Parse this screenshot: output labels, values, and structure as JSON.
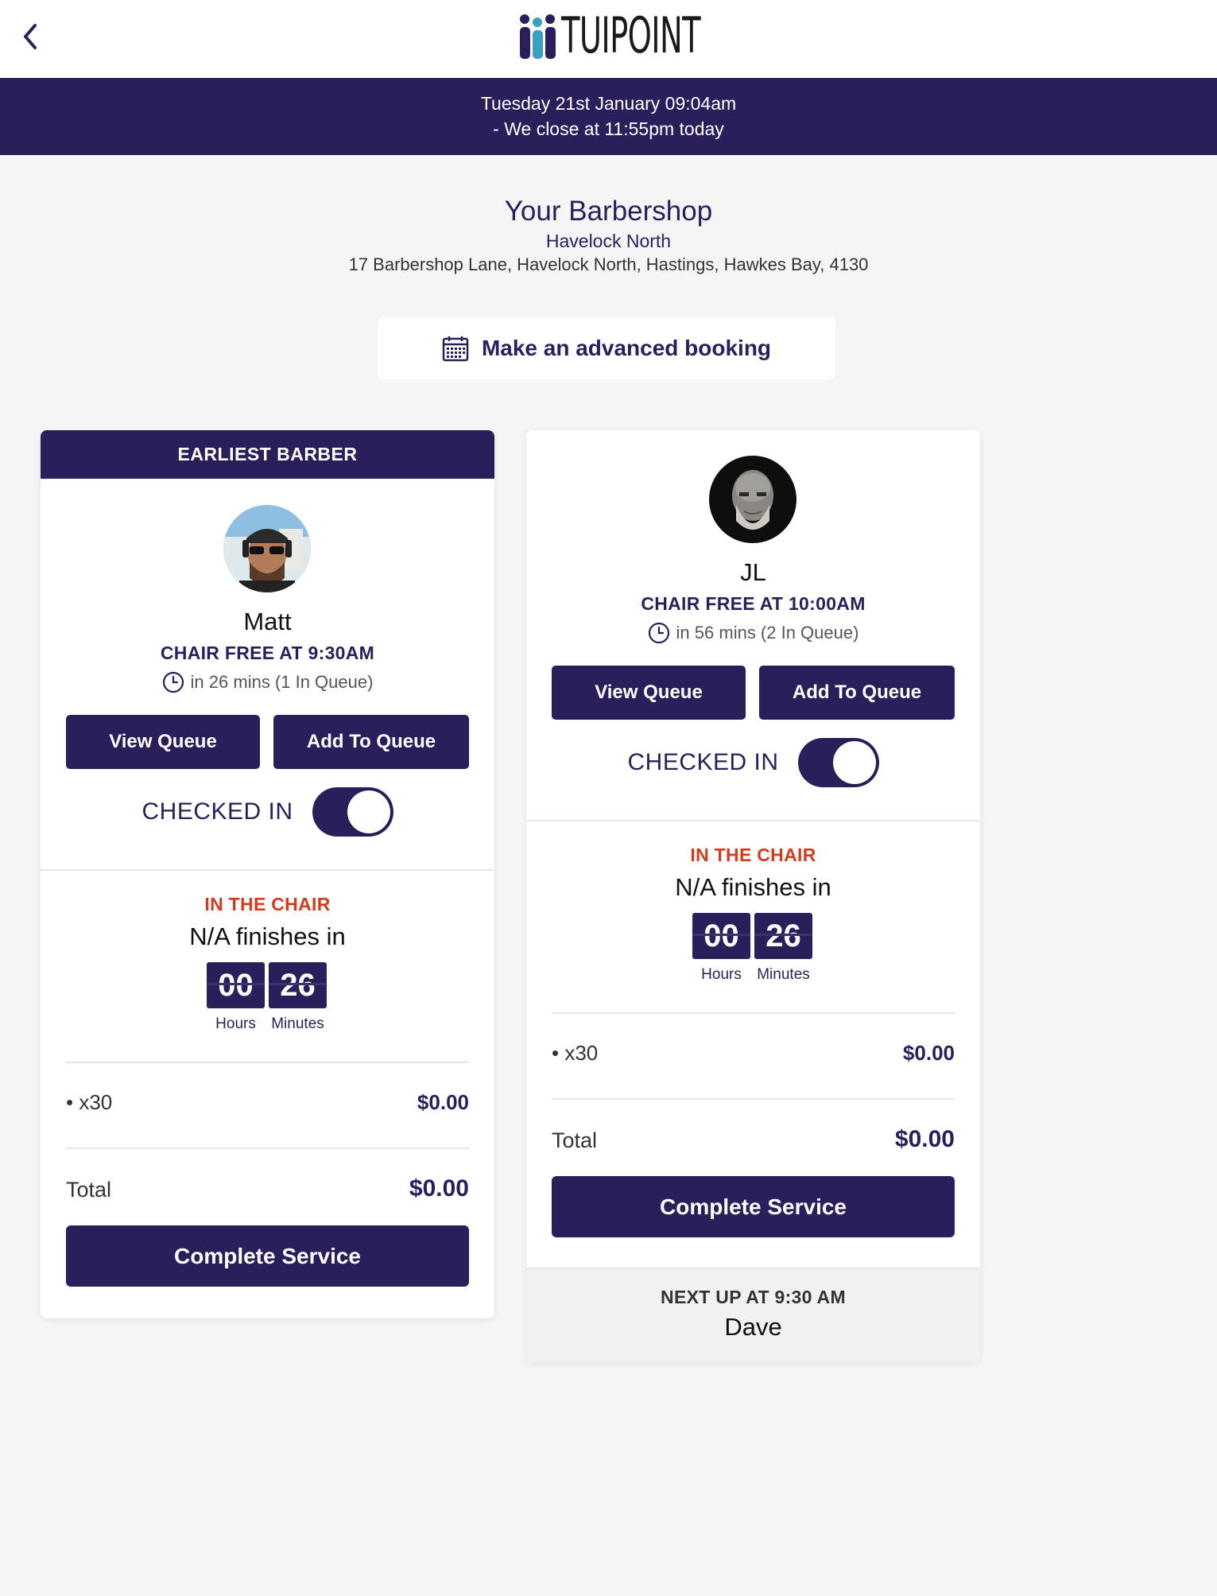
{
  "header": {
    "brand": "TUIPOINT",
    "back_icon": "chevron-left-icon"
  },
  "banner": {
    "datetime": "Tuesday 21st January 09:04am",
    "closing": "- We close at 11:55pm today"
  },
  "shop": {
    "name": "Your Barbershop",
    "area": "Havelock North",
    "address": "17 Barbershop Lane, Havelock North, Hastings, Hawkes Bay, 4130"
  },
  "booking": {
    "label": "Make an advanced booking",
    "icon": "calendar-icon"
  },
  "barbers": [
    {
      "badge": "EARLIEST BARBER",
      "name": "Matt",
      "chair_free": "CHAIR FREE AT 9:30AM",
      "queue_info": "in 26 mins (1 In Queue)",
      "view_queue": "View Queue",
      "add_to_queue": "Add To Queue",
      "checked_in_label": "CHECKED IN",
      "checked_in": true,
      "in_chair_label": "IN THE CHAIR",
      "finishes": "N/A finishes in",
      "hours": "00",
      "minutes": "26",
      "hours_label": "Hours",
      "minutes_label": "Minutes",
      "item_name": "x30",
      "item_price": "$0.00",
      "total_label": "Total",
      "total_price": "$0.00",
      "complete": "Complete Service"
    },
    {
      "name": "JL",
      "chair_free": "CHAIR FREE AT 10:00AM",
      "queue_info": "in 56 mins (2 In Queue)",
      "view_queue": "View Queue",
      "add_to_queue": "Add To Queue",
      "checked_in_label": "CHECKED IN",
      "checked_in": true,
      "in_chair_label": "IN THE CHAIR",
      "finishes": "N/A finishes in",
      "hours": "00",
      "minutes": "26",
      "hours_label": "Hours",
      "minutes_label": "Minutes",
      "item_name": "x30",
      "item_price": "$0.00",
      "total_label": "Total",
      "total_price": "$0.00",
      "complete": "Complete Service",
      "next_up_label": "NEXT UP AT 9:30 AM",
      "next_up_name": "Dave"
    }
  ],
  "colors": {
    "primary": "#2b1f5b",
    "alert": "#d63a1a",
    "background": "#f5f5f5"
  }
}
